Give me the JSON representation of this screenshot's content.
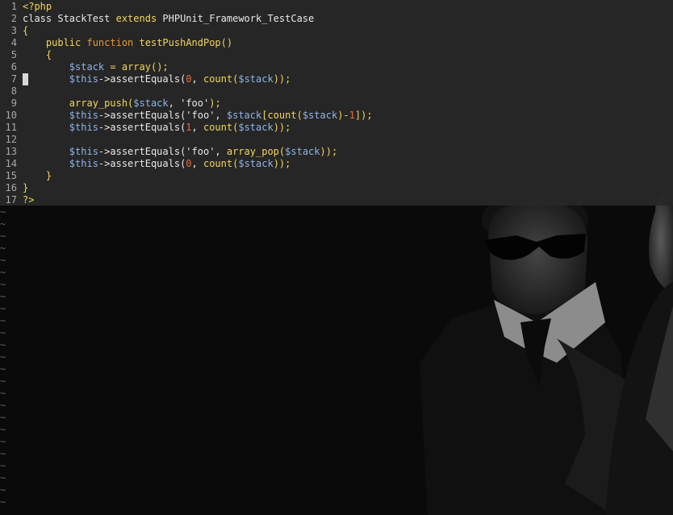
{
  "editor": {
    "lines": [
      {
        "number": "1",
        "segments": [
          {
            "text": "<?php",
            "color": "#f3d55e"
          }
        ]
      },
      {
        "number": "2",
        "segments": [
          {
            "text": "class ",
            "color": "#e8e8e8"
          },
          {
            "text": "StackTest ",
            "color": "#e8e8e8"
          },
          {
            "text": "extends ",
            "color": "#f3d55e"
          },
          {
            "text": "PHPUnit_Framework_TestCase",
            "color": "#e8e8e8"
          }
        ]
      },
      {
        "number": "3",
        "segments": [
          {
            "text": "{",
            "color": "#f3d55e"
          }
        ]
      },
      {
        "number": "4",
        "segments": [
          {
            "text": "    public ",
            "color": "#f3d55e"
          },
          {
            "text": "function ",
            "color": "#e39a35"
          },
          {
            "text": "testPushAndPop",
            "color": "#f3d55e"
          },
          {
            "text": "()",
            "color": "#f3d55e"
          }
        ]
      },
      {
        "number": "5",
        "segments": [
          {
            "text": "    {",
            "color": "#f3d55e"
          }
        ]
      },
      {
        "number": "6",
        "segments": [
          {
            "text": "        $stack",
            "color": "#8fb4e6"
          },
          {
            "text": " = ",
            "color": "#f3d55e"
          },
          {
            "text": "array",
            "color": "#f3d55e"
          },
          {
            "text": "();",
            "color": "#f3d55e"
          }
        ]
      },
      {
        "number": "7",
        "segments": [
          {
            "text": "        $this",
            "color": "#8fb4e6"
          },
          {
            "text": "->assertEquals(",
            "color": "#e8e8e8"
          },
          {
            "text": "0",
            "color": "#e96a3c"
          },
          {
            "text": ", ",
            "color": "#e8e8e8"
          },
          {
            "text": "count",
            "color": "#f3d55e"
          },
          {
            "text": "(",
            "color": "#f3d55e"
          },
          {
            "text": "$stack",
            "color": "#8fb4e6"
          },
          {
            "text": "));",
            "color": "#f3d55e"
          }
        ]
      },
      {
        "number": "8",
        "segments": []
      },
      {
        "number": "9",
        "segments": [
          {
            "text": "        array_push",
            "color": "#f3d55e"
          },
          {
            "text": "(",
            "color": "#f3d55e"
          },
          {
            "text": "$stack",
            "color": "#8fb4e6"
          },
          {
            "text": ", ",
            "color": "#e8e8e8"
          },
          {
            "text": "'foo'",
            "color": "#e8e8e8"
          },
          {
            "text": ");",
            "color": "#f3d55e"
          }
        ]
      },
      {
        "number": "10",
        "segments": [
          {
            "text": "        $this",
            "color": "#8fb4e6"
          },
          {
            "text": "->assertEquals(",
            "color": "#e8e8e8"
          },
          {
            "text": "'foo'",
            "color": "#e8e8e8"
          },
          {
            "text": ", ",
            "color": "#e8e8e8"
          },
          {
            "text": "$stack",
            "color": "#8fb4e6"
          },
          {
            "text": "[",
            "color": "#f3d55e"
          },
          {
            "text": "count",
            "color": "#f3d55e"
          },
          {
            "text": "(",
            "color": "#f3d55e"
          },
          {
            "text": "$stack",
            "color": "#8fb4e6"
          },
          {
            "text": ")-",
            "color": "#f3d55e"
          },
          {
            "text": "1",
            "color": "#e96a3c"
          },
          {
            "text": "]);",
            "color": "#f3d55e"
          }
        ]
      },
      {
        "number": "11",
        "segments": [
          {
            "text": "        $this",
            "color": "#8fb4e6"
          },
          {
            "text": "->assertEquals(",
            "color": "#e8e8e8"
          },
          {
            "text": "1",
            "color": "#e96a3c"
          },
          {
            "text": ", ",
            "color": "#e8e8e8"
          },
          {
            "text": "count",
            "color": "#f3d55e"
          },
          {
            "text": "(",
            "color": "#f3d55e"
          },
          {
            "text": "$stack",
            "color": "#8fb4e6"
          },
          {
            "text": "));",
            "color": "#f3d55e"
          }
        ]
      },
      {
        "number": "12",
        "segments": []
      },
      {
        "number": "13",
        "segments": [
          {
            "text": "        $this",
            "color": "#8fb4e6"
          },
          {
            "text": "->assertEquals(",
            "color": "#e8e8e8"
          },
          {
            "text": "'foo'",
            "color": "#e8e8e8"
          },
          {
            "text": ", ",
            "color": "#e8e8e8"
          },
          {
            "text": "array_pop",
            "color": "#f3d55e"
          },
          {
            "text": "(",
            "color": "#f3d55e"
          },
          {
            "text": "$stack",
            "color": "#8fb4e6"
          },
          {
            "text": "));",
            "color": "#f3d55e"
          }
        ]
      },
      {
        "number": "14",
        "segments": [
          {
            "text": "        $this",
            "color": "#8fb4e6"
          },
          {
            "text": "->assertEquals(",
            "color": "#e8e8e8"
          },
          {
            "text": "0",
            "color": "#e96a3c"
          },
          {
            "text": ", ",
            "color": "#e8e8e8"
          },
          {
            "text": "count",
            "color": "#f3d55e"
          },
          {
            "text": "(",
            "color": "#f3d55e"
          },
          {
            "text": "$stack",
            "color": "#8fb4e6"
          },
          {
            "text": "));",
            "color": "#f3d55e"
          }
        ]
      },
      {
        "number": "15",
        "segments": [
          {
            "text": "    }",
            "color": "#f3d55e"
          }
        ]
      },
      {
        "number": "16",
        "segments": [
          {
            "text": "}",
            "color": "#f3d55e"
          }
        ]
      },
      {
        "number": "17",
        "segments": [
          {
            "text": "?>",
            "color": "#f3d55e"
          }
        ]
      }
    ],
    "cursor_line": "7",
    "empty_line_marker": "~",
    "empty_line_count": 25,
    "colors": {
      "panel_background": "#282828",
      "line_number": "#a8a8a8",
      "tilde": "#606060",
      "cursor": "#d8d8d8"
    }
  }
}
